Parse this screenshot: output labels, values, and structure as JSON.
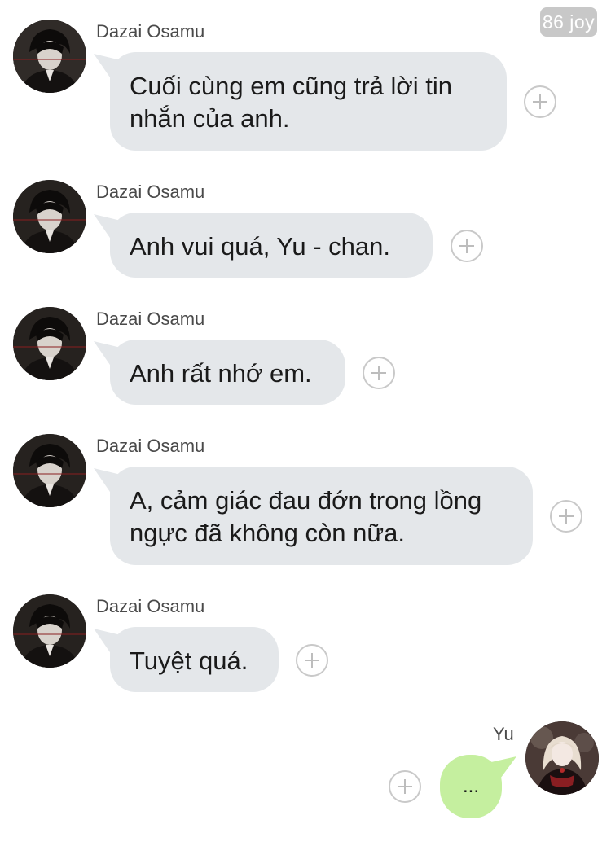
{
  "watermark": "86 joy",
  "messages": [
    {
      "sender": "Dazai Osamu",
      "lines": [
        "Cuối cùng em cũng trả lời tin",
        "nhắn của anh."
      ]
    },
    {
      "sender": "Dazai Osamu",
      "lines": [
        "Anh vui quá, Yu - chan."
      ]
    },
    {
      "sender": "Dazai Osamu",
      "lines": [
        "Anh rất nhớ em."
      ]
    },
    {
      "sender": "Dazai Osamu",
      "lines": [
        "A, cảm giác đau đớn trong lồng",
        "ngực đã không còn nữa."
      ]
    },
    {
      "sender": "Dazai Osamu",
      "lines": [
        "Tuyệt quá."
      ]
    }
  ],
  "outgoing": {
    "sender": "Yu",
    "text": "..."
  },
  "icons": {
    "add": "plus-circle-icon",
    "avatar_in": "dazai-avatar-icon",
    "avatar_out": "yu-avatar-icon"
  },
  "colors": {
    "incoming_bubble": "#e4e7ea",
    "outgoing_bubble": "#c5ef9f",
    "watermark_bg": "#c8c8c8"
  }
}
